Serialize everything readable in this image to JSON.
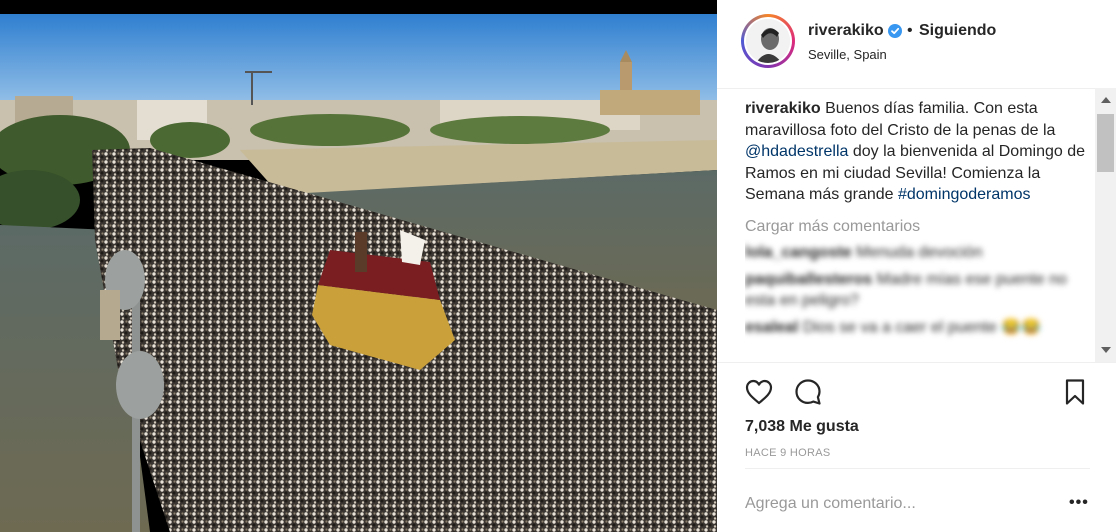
{
  "post": {
    "username": "riverakiko",
    "dot": "•",
    "follow_status": "Siguiendo",
    "location": "Seville, Spain"
  },
  "caption": {
    "author": "riverakiko",
    "text_part1": "Buenos días familia. Con esta maravillosa foto del Cristo de la penas de la ",
    "mention": "@hdadestrella",
    "text_part2": " doy la bienvenida al Domingo de Ramos en mi ciudad Sevilla! Comienza la Semana más grande ",
    "hashtag": "#domingoderamos"
  },
  "load_more": "Cargar más comentarios",
  "comments": [
    {
      "user": "lola_cangoste",
      "text": "Menuda devoción"
    },
    {
      "user": "paquiballesteros",
      "text": "Madre mías ese puente no esta en peligro?"
    },
    {
      "user": "esaleal",
      "text": "Dios se va a caer el puente 😂😂"
    }
  ],
  "likes": "7,038 Me gusta",
  "time_ago": "HACE 9 HORAS",
  "add_comment_placeholder": "Agrega un comentario...",
  "more_options": "•••",
  "icons": {
    "like": "heart-icon",
    "comment": "comment-bubble-icon",
    "save": "bookmark-icon",
    "verified": "verified-badge-icon"
  },
  "colors": {
    "link": "#003569",
    "verified": "#3897f0",
    "muted": "#999999"
  }
}
